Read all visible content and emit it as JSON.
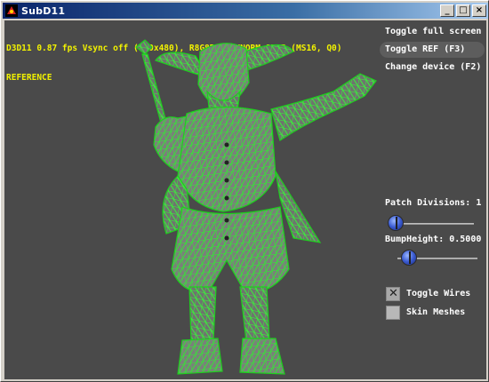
{
  "window": {
    "title": "SubD11"
  },
  "titlebar_buttons": {
    "minimize": "_",
    "maximize": "□",
    "close": "×"
  },
  "stats": {
    "line1": "D3D11 0.87 fps Vsync off (640x480), R8G8B8A8_UNORM_SRGB (MS16, Q0)",
    "line2": "REFERENCE"
  },
  "buttons": {
    "toggle_full_screen": "Toggle full screen",
    "toggle_ref": "Toggle REF (F3)",
    "change_device": "Change device (F2)"
  },
  "sliders": {
    "patch_divisions_label": "Patch Divisions: 1",
    "patch_divisions_value": 0.0,
    "bump_height_label": "BumpHeight: 0.5000",
    "bump_height_value": 0.2
  },
  "checkboxes": {
    "toggle_wires": {
      "label": "Toggle Wires",
      "checked": true
    },
    "skin_meshes": {
      "label": "Skin Meshes",
      "checked": false
    }
  },
  "colors": {
    "wireframe": "#33ff33",
    "stats_text": "#f2f200",
    "viewport_bg": "#4a4a4a"
  }
}
